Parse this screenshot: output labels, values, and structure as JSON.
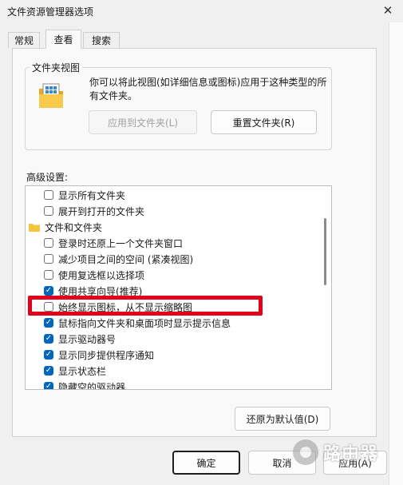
{
  "window": {
    "title": "文件资源管理器选项",
    "close_glyph": "✕"
  },
  "tabs": [
    {
      "label": "常规",
      "active": false
    },
    {
      "label": "查看",
      "active": true
    },
    {
      "label": "搜索",
      "active": false
    }
  ],
  "folder_view": {
    "group_label": "文件夹视图",
    "description": "你可以将此视图(如详细信息或图标)应用于这种类型的所有文件夹。",
    "apply_button": "应用到文件夹(L)",
    "reset_button": "重置文件夹(R)"
  },
  "advanced": {
    "label": "高级设置:",
    "items": [
      {
        "type": "checkbox",
        "label": "显示所有文件夹",
        "checked": false
      },
      {
        "type": "checkbox",
        "label": "展开到打开的文件夹",
        "checked": false
      },
      {
        "type": "folder",
        "label": "文件和文件夹"
      },
      {
        "type": "checkbox",
        "label": "登录时还原上一个文件夹窗口",
        "checked": false
      },
      {
        "type": "checkbox",
        "label": "减少项目之间的空间 (紧凑视图)",
        "checked": false
      },
      {
        "type": "checkbox",
        "label": "使用复选框以选择项",
        "checked": false
      },
      {
        "type": "checkbox",
        "label": "使用共享向导(推荐)",
        "checked": true
      },
      {
        "type": "checkbox",
        "label": "始终显示图标，从不显示缩略图",
        "checked": false
      },
      {
        "type": "checkbox",
        "label": "鼠标指向文件夹和桌面项时显示提示信息",
        "checked": true
      },
      {
        "type": "checkbox",
        "label": "显示驱动器号",
        "checked": true
      },
      {
        "type": "checkbox",
        "label": "显示同步提供程序通知",
        "checked": true
      },
      {
        "type": "checkbox",
        "label": "显示状态栏",
        "checked": true
      },
      {
        "type": "checkbox",
        "label": "隐藏空的驱动器",
        "checked": true
      }
    ],
    "restore_defaults_button": "还原为默认值(D)"
  },
  "footer": {
    "ok": "确定",
    "cancel": "取消",
    "apply": "应用(A)"
  },
  "watermark": {
    "text": "路由器"
  },
  "colors": {
    "check_blue": "#0067c0",
    "highlight_red": "#e3001a",
    "folder_yellow": "#f5c542"
  }
}
